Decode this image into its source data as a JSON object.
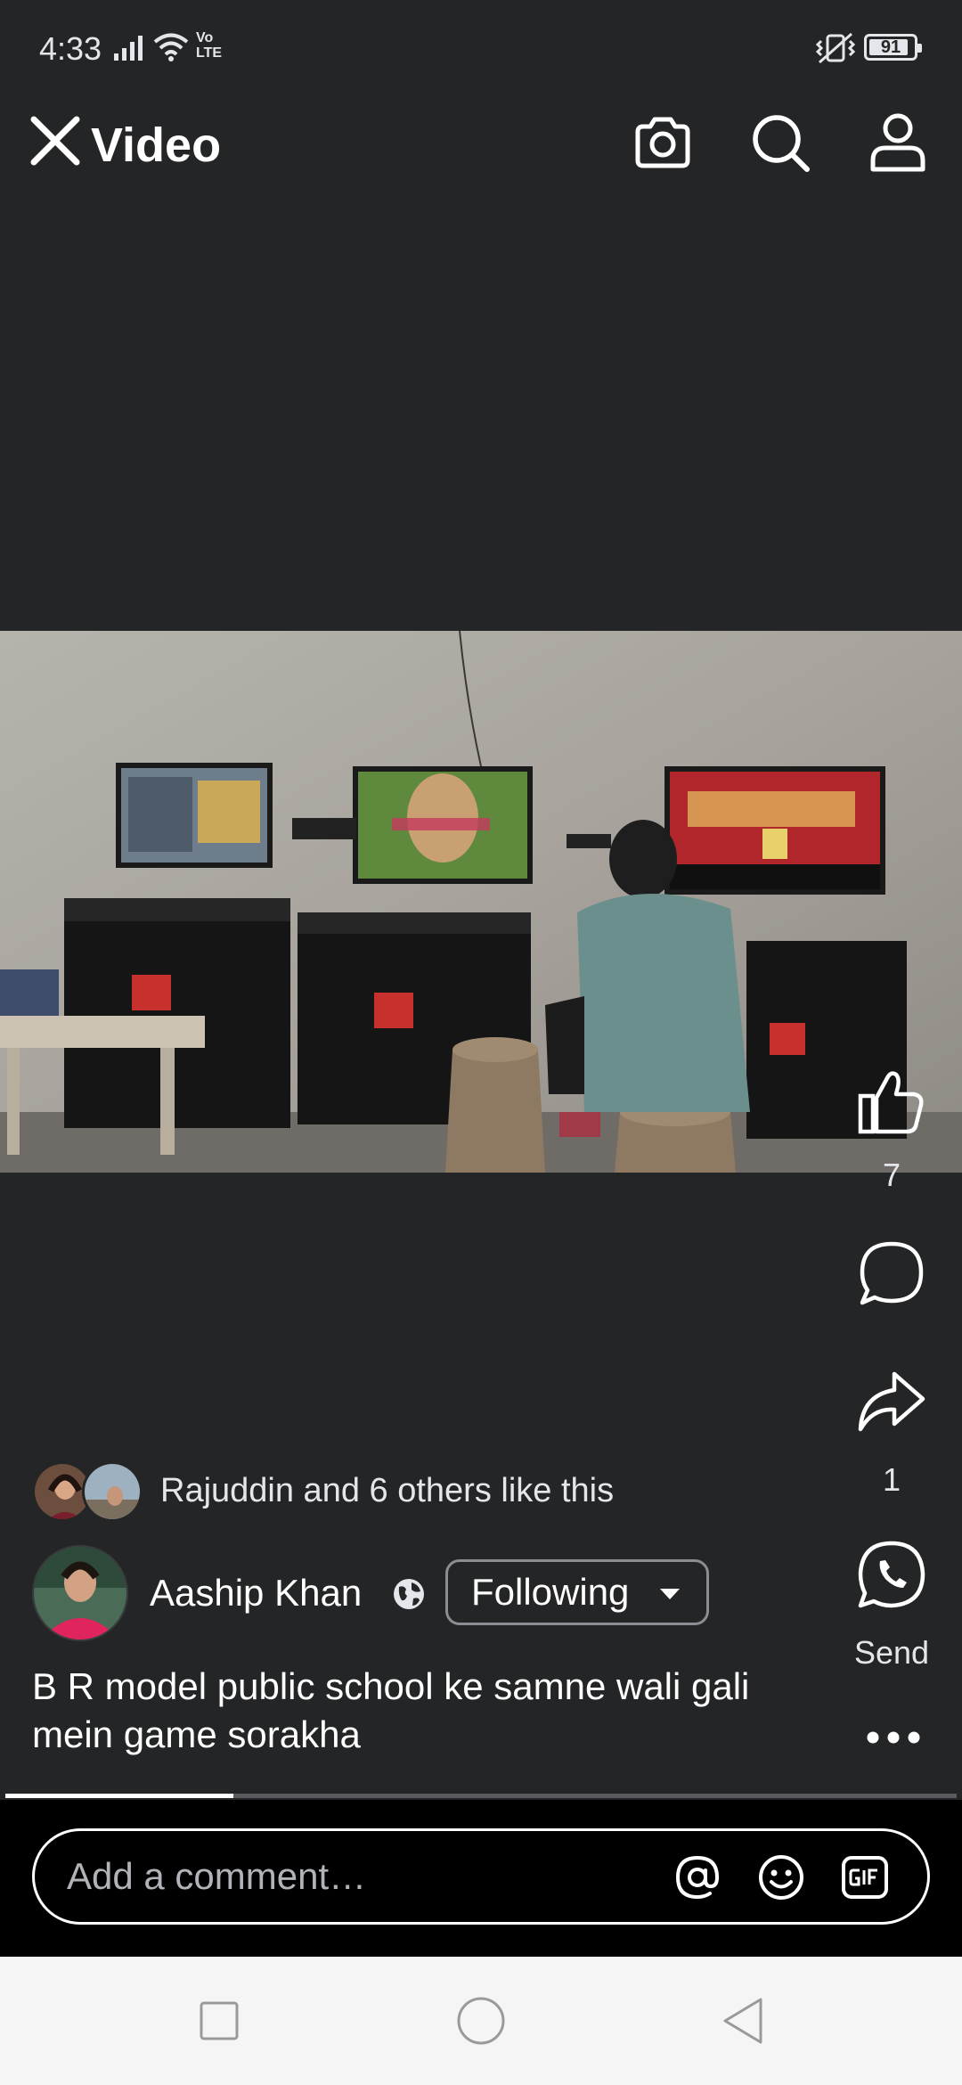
{
  "status_bar": {
    "time": "4:33",
    "network": "Vo LTE",
    "battery": "91",
    "battery_level": 0.91
  },
  "header": {
    "title": "Video"
  },
  "video": {
    "progress": 0.24
  },
  "actions": {
    "like_count": "7",
    "share_count": "1",
    "send_label": "Send"
  },
  "likes": {
    "text": "Rajuddin and 6 others like this"
  },
  "post": {
    "author": "Aaship Khan",
    "follow_label": "Following",
    "caption": "B R model public school ke samne wali gali mein game sorakha"
  },
  "comment": {
    "placeholder": "Add a comment…"
  },
  "colors": {
    "background": "#242526",
    "comment_bar": "#000000",
    "nav_bar": "#f5f5f5"
  }
}
